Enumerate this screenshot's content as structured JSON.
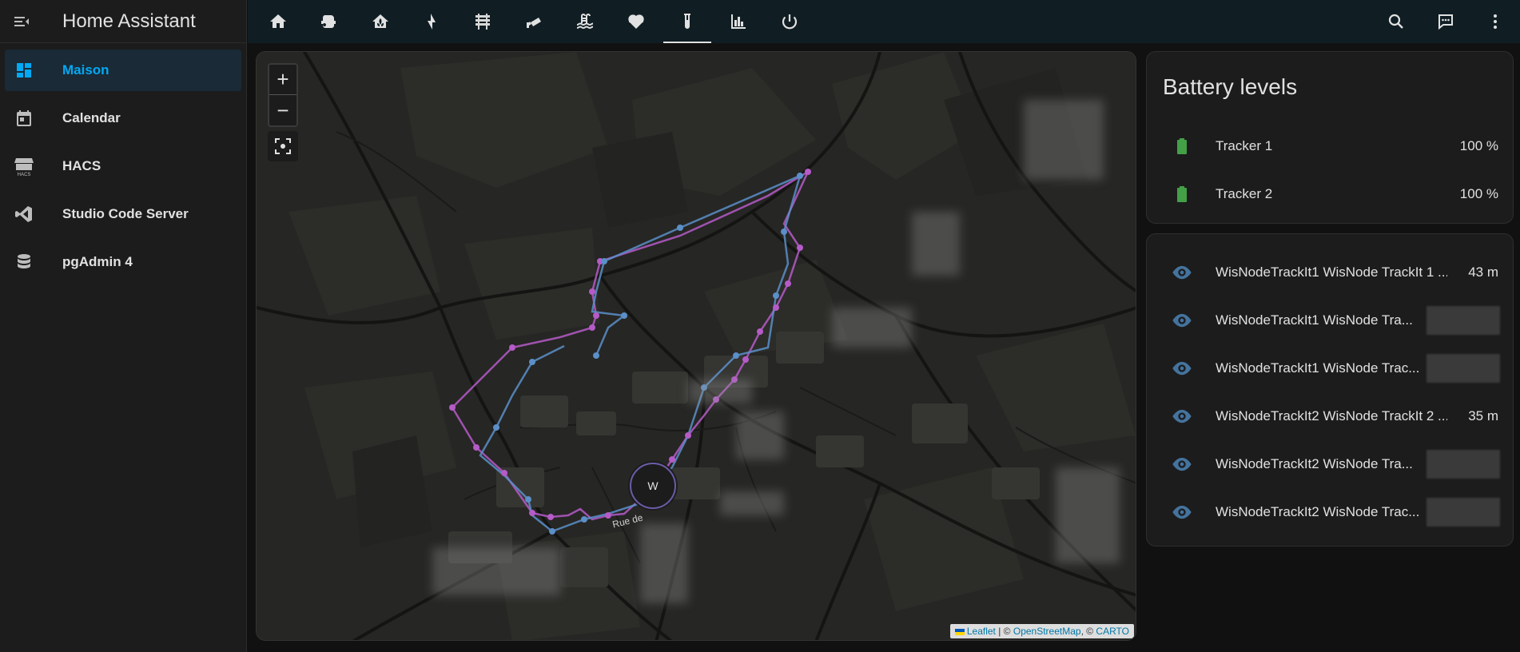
{
  "app": {
    "title": "Home Assistant"
  },
  "sidebar": {
    "items": [
      {
        "label": "Maison",
        "icon": "dashboard-icon",
        "active": true
      },
      {
        "label": "Calendar",
        "icon": "calendar-icon",
        "active": false
      },
      {
        "label": "HACS",
        "icon": "hacs-store-icon",
        "active": false
      },
      {
        "label": "Studio Code Server",
        "icon": "vscode-icon",
        "active": false
      },
      {
        "label": "pgAdmin 4",
        "icon": "database-icon",
        "active": false
      }
    ]
  },
  "topbar": {
    "tabs": [
      {
        "icon": "home-icon"
      },
      {
        "icon": "robot-vacuum-icon"
      },
      {
        "icon": "home-plant-icon"
      },
      {
        "icon": "lightning-icon"
      },
      {
        "icon": "radiator-icon"
      },
      {
        "icon": "cctv-icon"
      },
      {
        "icon": "pool-icon"
      },
      {
        "icon": "heart-pulse-icon"
      },
      {
        "icon": "test-tube-icon",
        "active": true
      },
      {
        "icon": "chart-icon"
      },
      {
        "icon": "power-icon"
      }
    ],
    "actions": [
      {
        "icon": "search-icon"
      },
      {
        "icon": "assist-chat-icon"
      },
      {
        "icon": "more-vertical-icon"
      }
    ]
  },
  "map": {
    "zoom_in": "+",
    "zoom_out": "−",
    "marker_label": "W",
    "street_label": "Rue de",
    "attribution": {
      "leaflet": "Leaflet",
      "sep1": " | © ",
      "osm": "OpenStreetMap",
      "sep2": ", © ",
      "carto": "CARTO"
    },
    "colors": {
      "track_purple": "#b55bc8",
      "track_blue": "#5b8fc8"
    }
  },
  "battery_card": {
    "title": "Battery levels",
    "rows": [
      {
        "name": "Tracker 1",
        "value": "100 %",
        "icon": "battery-full-icon"
      },
      {
        "name": "Tracker 2",
        "value": "100 %",
        "icon": "battery-full-icon"
      }
    ],
    "battery_color": "#43a047"
  },
  "entities_card": {
    "rows": [
      {
        "name": "WisNodeTrackIt1 WisNode TrackIt 1 ...",
        "value": "43 m",
        "icon": "eye-icon"
      },
      {
        "name": "WisNodeTrackIt1 WisNode Tra...",
        "value": "",
        "icon": "eye-icon"
      },
      {
        "name": "WisNodeTrackIt1 WisNode Trac...",
        "value": "",
        "icon": "eye-icon"
      },
      {
        "name": "WisNodeTrackIt2 WisNode TrackIt 2 ...",
        "value": "35 m",
        "icon": "eye-icon"
      },
      {
        "name": "WisNodeTrackIt2 WisNode Tra...",
        "value": "",
        "icon": "eye-icon"
      },
      {
        "name": "WisNodeTrackIt2 WisNode Trac...",
        "value": "",
        "icon": "eye-icon"
      }
    ],
    "icon_color": "#44739e"
  }
}
